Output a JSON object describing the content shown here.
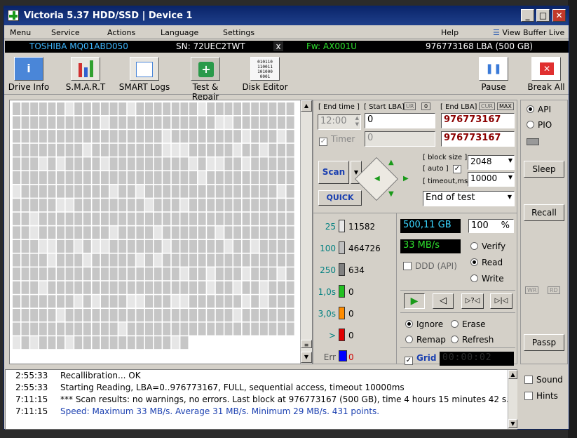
{
  "window": {
    "title": "Victoria 5.37 HDD/SSD | Device 1"
  },
  "menu": {
    "items": [
      "Menu",
      "Service",
      "Actions",
      "Language",
      "Settings",
      "Help"
    ],
    "view_buffer": "View Buffer Live"
  },
  "infobar": {
    "model": "TOSHIBA MQ01ABD050",
    "serial": "SN: 72UEC2TWT",
    "close": "x",
    "firmware": "Fw: AX001U",
    "capacity": "976773168 LBA (500 GB)"
  },
  "toolbar": {
    "drive_info": "Drive Info",
    "smart": "S.M.A.R.T",
    "smart_logs": "SMART Logs",
    "test_repair": "Test & Repair",
    "disk_editor": "Disk Editor",
    "pause": "Pause",
    "break_all": "Break All"
  },
  "controls": {
    "end_time_label": "[ End time ]",
    "end_time_value": "12:00",
    "start_lba_label": "[ Start LBA]",
    "start_lba_ur": "UR",
    "start_lba_zero": "0",
    "start_lba_value": "0",
    "end_lba_label": "[ End LBA]",
    "end_lba_cur": "CUR",
    "end_lba_max": "MAX",
    "end_lba_value": "976773167",
    "timer_label": "Timer",
    "timer_value": "0",
    "end_lba_value2": "976773167",
    "block_size_label": "[ block size ]",
    "auto_label": "[ auto ]",
    "block_size_value": "2048",
    "timeout_label": "[ timeout,ms ]",
    "timeout_value": "10000",
    "scan": "Scan",
    "quick": "QUICK",
    "end_mode": "End of test"
  },
  "legend": [
    {
      "key": "25",
      "value": "11582",
      "color": "#e8e8e8"
    },
    {
      "key": "100",
      "value": "464726",
      "color": "#c0c0c0"
    },
    {
      "key": "250",
      "value": "634",
      "color": "#808080"
    },
    {
      "key": "1,0s",
      "value": "0",
      "color": "#22c022"
    },
    {
      "key": "3,0s",
      "value": "0",
      "color": "#ff8c00"
    },
    {
      "key": ">",
      "value": "0",
      "color": "#e00000"
    },
    {
      "key": "Err",
      "value": "0",
      "color": "#0000ff"
    }
  ],
  "stats": {
    "size": "500,11 GB",
    "percent": "100",
    "percent_sign": "%",
    "speed": "33 MB/s",
    "ddd": "DDD (API)",
    "verify": "Verify",
    "read": "Read",
    "write": "Write"
  },
  "actions": {
    "ignore": "Ignore",
    "erase": "Erase",
    "remap": "Remap",
    "refresh": "Refresh",
    "grid": "Grid",
    "timer": "00:00:02"
  },
  "side": {
    "api": "API",
    "pio": "PIO",
    "sleep": "Sleep",
    "recall": "Recall",
    "wr": "WR",
    "rd": "RD",
    "passp": "Passp",
    "sound": "Sound",
    "hints": "Hints"
  },
  "log": [
    {
      "time": "2:55:33",
      "msg": "Recallibration... OK",
      "color": "#000"
    },
    {
      "time": "2:55:33",
      "msg": "Starting Reading, LBA=0..976773167, FULL, sequential access, timeout 10000ms",
      "color": "#000"
    },
    {
      "time": "7:11:15",
      "msg": "*** Scan results: no warnings, no errors. Last block at 976773167 (500 GB), time 4 hours 15 minutes 42 s...",
      "color": "#000"
    },
    {
      "time": "7:11:15",
      "msg": "Speed: Maximum 33 MB/s. Average 31 MB/s. Minimum 29 MB/s. 431 points.",
      "color": "#1a3fb0"
    }
  ]
}
